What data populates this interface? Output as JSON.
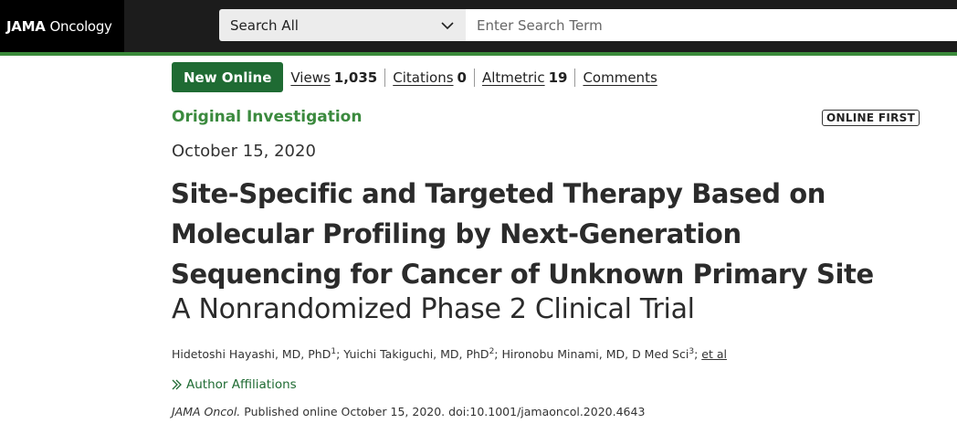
{
  "header": {
    "brand_bold": "JAMA",
    "brand_light": "Oncology",
    "search_scope": "Search All",
    "search_placeholder": "Enter Search Term"
  },
  "metrics": {
    "badge": "New Online",
    "views_label": "Views",
    "views_value": "1,035",
    "citations_label": "Citations",
    "citations_value": "0",
    "altmetric_label": "Altmetric",
    "altmetric_value": "19",
    "comments_label": "Comments"
  },
  "article": {
    "type": "Original Investigation",
    "online_first": "ONLINE FIRST",
    "date": "October 15, 2020",
    "title": "Site-Specific and Targeted Therapy Based on Molecular Profiling by Next-Generation Sequencing for Cancer of Unknown Primary Site",
    "subtitle": "A Nonrandomized Phase 2 Clinical Trial",
    "authors": [
      {
        "name": "Hidetoshi Hayashi, MD, PhD",
        "sup": "1"
      },
      {
        "name": "Yuichi Takiguchi, MD, PhD",
        "sup": "2"
      },
      {
        "name": "Hironobu Minami, MD, D Med Sci",
        "sup": "3"
      }
    ],
    "et_al": "et al",
    "affiliations_label": "Author Affiliations",
    "journal_abbrev": "JAMA Oncol.",
    "citation_rest": "Published online October 15, 2020. doi:10.1001/jamaoncol.2020.4643"
  },
  "colors": {
    "accent_green": "#3b8a3e",
    "badge_green": "#1f6b33",
    "header_bg": "#1c1c1c"
  }
}
